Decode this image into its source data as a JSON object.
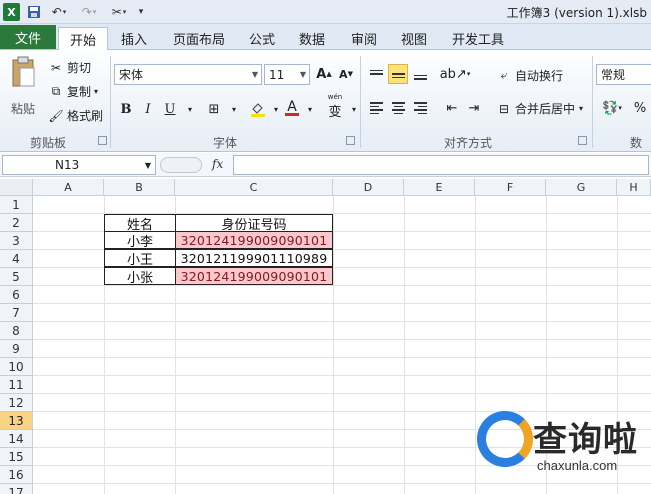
{
  "titlebar": {
    "title": "工作簿3 (version 1).xlsb",
    "quick_access": [
      "save-icon",
      "undo-icon",
      "redo-icon",
      "tools-icon"
    ]
  },
  "tabs": {
    "file": "文件",
    "items": [
      "开始",
      "插入",
      "页面布局",
      "公式",
      "数据",
      "审阅",
      "视图",
      "开发工具"
    ],
    "active": "开始"
  },
  "clipboard": {
    "paste": "粘贴",
    "cut": "剪切",
    "copy": "复制",
    "format_painter": "格式刷",
    "group_label": "剪贴板"
  },
  "font": {
    "name": "宋体",
    "size": "11",
    "bold": "B",
    "italic": "I",
    "underline": "U",
    "group_label": "字体",
    "wen": "wén"
  },
  "alignment": {
    "wrap_text": "自动换行",
    "merge_center": "合并后居中",
    "group_label": "对齐方式"
  },
  "number": {
    "format": "常规",
    "group_label": "数",
    "percent": "%"
  },
  "formula_bar": {
    "name_box": "N13",
    "fx": "fx",
    "formula": ""
  },
  "columns": [
    "A",
    "B",
    "C",
    "D",
    "E",
    "F",
    "G",
    "H"
  ],
  "rows": [
    "1",
    "2",
    "3",
    "4",
    "5",
    "6",
    "7",
    "8",
    "9",
    "10",
    "11",
    "12",
    "13",
    "14",
    "15",
    "16",
    "17"
  ],
  "selected_row": "13",
  "table": {
    "headers": [
      "姓名",
      "身份证号码"
    ],
    "rows": [
      {
        "name": "小李",
        "id": "320124199009090101",
        "duplicate": true
      },
      {
        "name": "小王",
        "id": "320121199901110989",
        "duplicate": false
      },
      {
        "name": "小张",
        "id": "320124199009090101",
        "duplicate": true
      }
    ]
  },
  "colors": {
    "duplicate_fill": "#f8c8cc",
    "duplicate_text": "#8a1820",
    "file_tab": "#2b7a3b",
    "selected_row": "#f8d384"
  },
  "watermark": {
    "text": "查询啦",
    "url": "chaxunla.com"
  }
}
